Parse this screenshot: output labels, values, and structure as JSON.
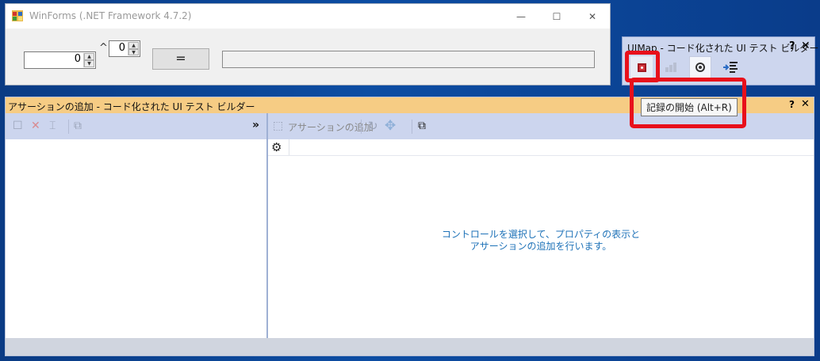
{
  "winforms": {
    "title": "WinForms (.NET Framework 4.7.2)",
    "minimize_glyph": "—",
    "maximize_glyph": "☐",
    "close_glyph": "✕",
    "number1": "0",
    "power_symbol": "^",
    "number2": "0",
    "equals_label": "=",
    "result": ""
  },
  "uimap": {
    "title": "UIMap - コード化された UI テスト ビルダー",
    "help": "?",
    "close": "✕",
    "toolbar": [
      "record-icon",
      "pause-icon",
      "crosshair-target-icon",
      "generate-code-icon"
    ]
  },
  "tooltip": {
    "text": "記録の開始 (Alt+R)"
  },
  "builder": {
    "title": "アサーションの追加 - コード化された UI テスト ビルダー",
    "help": "?",
    "close": "✕",
    "expand": "»",
    "add_assertion_label": "アサーションの追加",
    "message_line1": "コントロールを選択して、プロパティの表示と",
    "message_line2": "アサーションの追加を行います。"
  },
  "colors": {
    "highlight": "#e8101b",
    "builder_titlebar": "#f6cc84",
    "toolbar": "#ccd5ee",
    "message": "#1e72b8"
  }
}
